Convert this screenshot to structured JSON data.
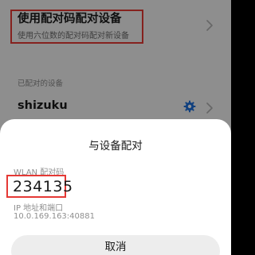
{
  "settings": {
    "pair_with_code": {
      "title": "使用配对码配对设备",
      "subtitle": "使用六位数的配对码配对新设备"
    },
    "paired_section_label": "已配对的设备",
    "paired_devices": [
      {
        "name": "shizuku"
      }
    ]
  },
  "dialog": {
    "title": "与设备配对",
    "code_label": "WLAN 配对码",
    "code_value": "234135",
    "ip_label": "IP 地址和端口",
    "ip_value": "10.0.169.163:40881",
    "cancel_label": "取消"
  },
  "colors": {
    "highlight_border": "#e53935",
    "gear_icon": "#1e6fd9",
    "sheet_background": "#ffffff"
  }
}
